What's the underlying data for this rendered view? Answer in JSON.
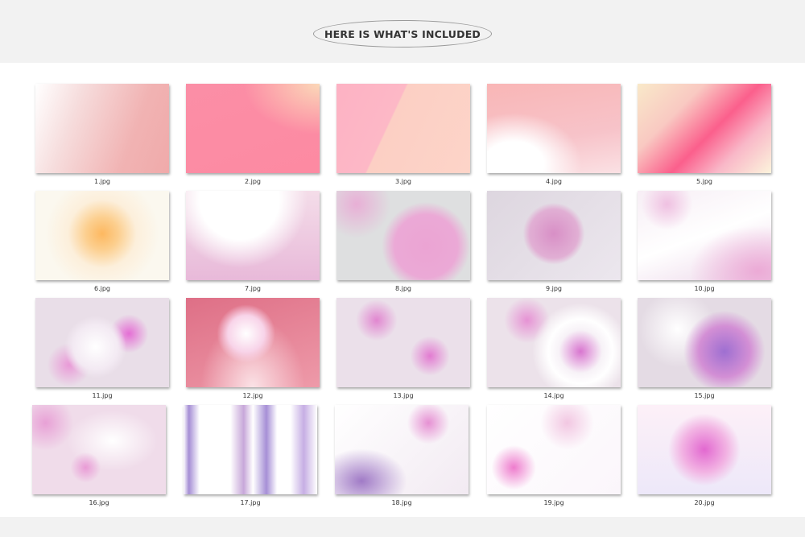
{
  "header": {
    "title": "HERE IS WHAT'S INCLUDED"
  },
  "files": [
    {
      "name": "1.jpg"
    },
    {
      "name": "2.jpg"
    },
    {
      "name": "3.jpg"
    },
    {
      "name": "4.jpg"
    },
    {
      "name": "5.jpg"
    },
    {
      "name": "6.jpg"
    },
    {
      "name": "7.jpg"
    },
    {
      "name": "8.jpg"
    },
    {
      "name": "9.jpg"
    },
    {
      "name": "10.jpg"
    },
    {
      "name": "11.jpg"
    },
    {
      "name": "12.jpg"
    },
    {
      "name": "13.jpg"
    },
    {
      "name": "14.jpg"
    },
    {
      "name": "15.jpg"
    },
    {
      "name": "16.jpg"
    },
    {
      "name": "17.jpg"
    },
    {
      "name": "18.jpg"
    },
    {
      "name": "19.jpg"
    },
    {
      "name": "20.jpg"
    }
  ]
}
